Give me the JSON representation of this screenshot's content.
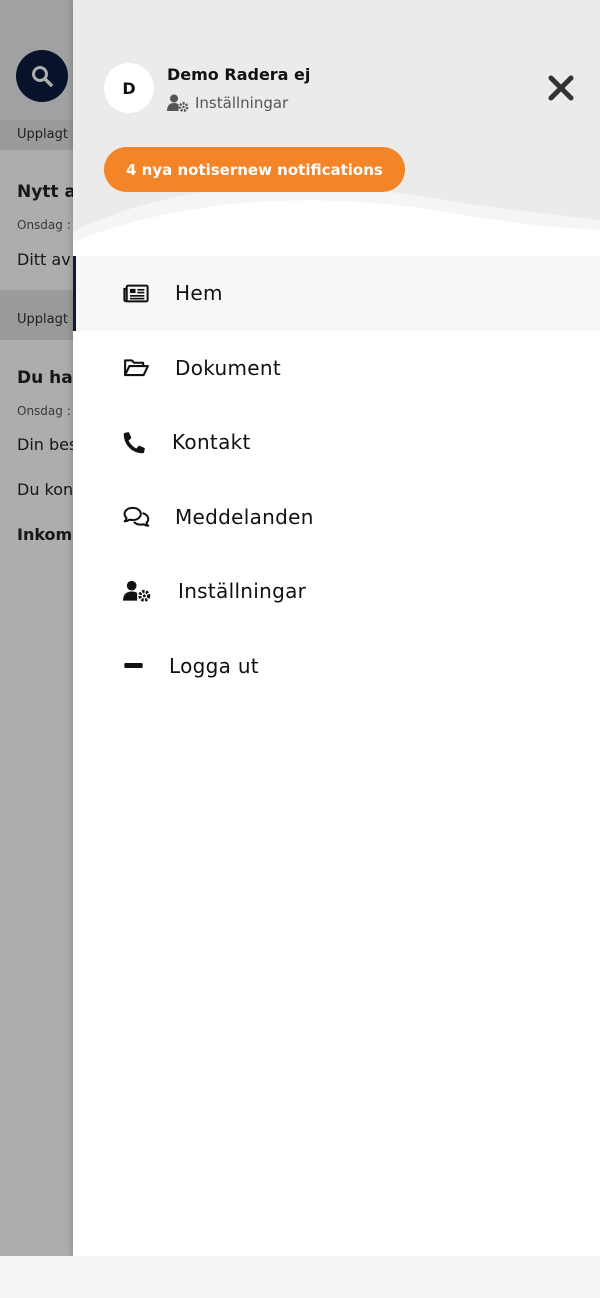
{
  "background": {
    "cards": [
      {
        "strip": "Upplagt :",
        "title": "Nytt a",
        "date": "Onsdag :",
        "body": "Ditt av"
      },
      {
        "strip": "Upplagt",
        "title": "Du har",
        "date": "Onsdag :",
        "body": "Din bes",
        "body2": "Du kon",
        "body3": "Inkom"
      }
    ]
  },
  "drawer": {
    "user": {
      "initial": "D",
      "name": "Demo Radera ej",
      "settings_label": "Inställningar"
    },
    "notifications_label": "4 nya notisernew notifications",
    "menu": [
      {
        "id": "hem",
        "label": "Hem",
        "icon": "newspaper-icon",
        "active": true
      },
      {
        "id": "dokument",
        "label": "Dokument",
        "icon": "folder-open-icon",
        "active": false
      },
      {
        "id": "kontakt",
        "label": "Kontakt",
        "icon": "phone-icon",
        "active": false
      },
      {
        "id": "meddelanden",
        "label": "Meddelanden",
        "icon": "comments-icon",
        "active": false
      },
      {
        "id": "installningar",
        "label": "Inställningar",
        "icon": "user-cog-icon",
        "active": false
      },
      {
        "id": "logga-ut",
        "label": "Logga ut",
        "icon": "minus-icon",
        "active": false
      }
    ]
  },
  "colors": {
    "accent": "#f38427",
    "navy": "#0d1b3e"
  }
}
